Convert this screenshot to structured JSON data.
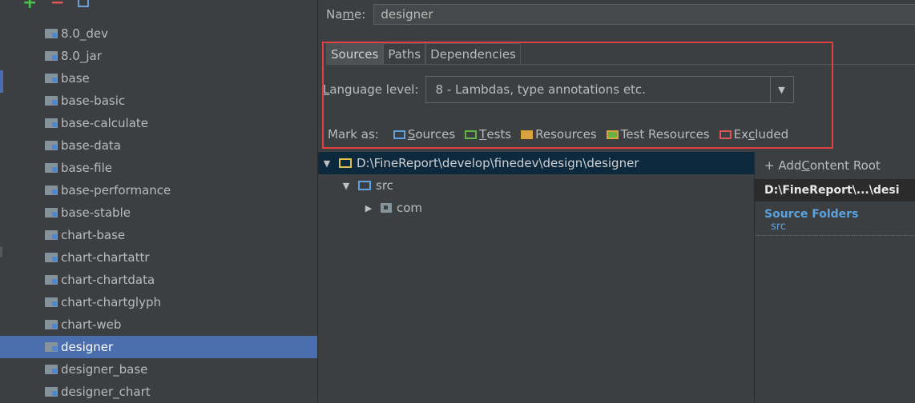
{
  "toolbar": {
    "add": "+",
    "remove": "−"
  },
  "modules": [
    "8.0_dev",
    "8.0_jar",
    "base",
    "base-basic",
    "base-calculate",
    "base-data",
    "base-file",
    "base-performance",
    "base-stable",
    "chart-base",
    "chart-chartattr",
    "chart-chartdata",
    "chart-chartglyph",
    "chart-web",
    "designer",
    "designer_base",
    "designer_chart"
  ],
  "selected_module": "designer",
  "name_field": {
    "label_pre": "Na",
    "label_u": "m",
    "label_post": "e:",
    "value": "designer"
  },
  "tabs": [
    "Sources",
    "Paths",
    "Dependencies"
  ],
  "language": {
    "label_u": "L",
    "label_rest": "anguage level:",
    "value": "8 - Lambdas, type annotations etc.",
    "arrow": "▼"
  },
  "mark_as": {
    "label": "Mark as:",
    "sources": {
      "u": "S",
      "rest": "ources"
    },
    "tests": {
      "u": "T",
      "rest": "ests"
    },
    "resources": "Resources",
    "test_resources": "Test Resources",
    "excluded": {
      "pre": "Ex",
      "u": "c",
      "rest": "luded"
    }
  },
  "tree": {
    "root": "D:\\FineReport\\develop\\finedev\\design\\designer",
    "src": "src",
    "com": "com",
    "expanded": "▼",
    "collapsed": "▶"
  },
  "content_panel": {
    "add_pre": "+ Add ",
    "add_u": "C",
    "add_rest": "ontent Root",
    "root_short": "D:\\FineReport\\...\\desi",
    "source_folders": "Source Folders",
    "source_item": "src"
  },
  "colors": {
    "selection": "#4b6eaf",
    "highlight_box": "#e0403f",
    "source_folder": "#5aa2e0",
    "test_folder": "#62b543",
    "resource_folder": "#d8a23c",
    "excluded_folder": "#e05555"
  }
}
